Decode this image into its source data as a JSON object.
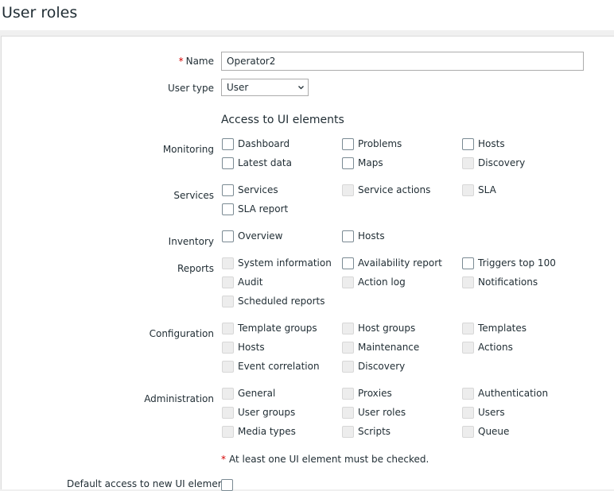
{
  "page": {
    "title": "User roles"
  },
  "form": {
    "name_label": "Name",
    "name_required_mark": "*",
    "name_value": "Operator2",
    "user_type_label": "User type",
    "user_type_value": "User",
    "section_heading": "Access to UI elements",
    "groups": [
      {
        "label": "Monitoring",
        "items": [
          {
            "label": "Dashboard",
            "checked": false,
            "disabled": false
          },
          {
            "label": "Problems",
            "checked": false,
            "disabled": false
          },
          {
            "label": "Hosts",
            "checked": false,
            "disabled": false
          },
          {
            "label": "Latest data",
            "checked": false,
            "disabled": false
          },
          {
            "label": "Maps",
            "checked": false,
            "disabled": false
          },
          {
            "label": "Discovery",
            "checked": false,
            "disabled": true
          }
        ]
      },
      {
        "label": "Services",
        "items": [
          {
            "label": "Services",
            "checked": false,
            "disabled": false
          },
          {
            "label": "Service actions",
            "checked": false,
            "disabled": true
          },
          {
            "label": "SLA",
            "checked": false,
            "disabled": true
          },
          {
            "label": "SLA report",
            "checked": false,
            "disabled": false
          }
        ]
      },
      {
        "label": "Inventory",
        "items": [
          {
            "label": "Overview",
            "checked": false,
            "disabled": false
          },
          {
            "label": "Hosts",
            "checked": false,
            "disabled": false
          }
        ]
      },
      {
        "label": "Reports",
        "items": [
          {
            "label": "System information",
            "checked": false,
            "disabled": true
          },
          {
            "label": "Availability report",
            "checked": false,
            "disabled": false
          },
          {
            "label": "Triggers top 100",
            "checked": false,
            "disabled": false
          },
          {
            "label": "Audit",
            "checked": false,
            "disabled": true
          },
          {
            "label": "Action log",
            "checked": false,
            "disabled": true
          },
          {
            "label": "Notifications",
            "checked": false,
            "disabled": true
          },
          {
            "label": "Scheduled reports",
            "checked": false,
            "disabled": true
          }
        ]
      },
      {
        "label": "Configuration",
        "items": [
          {
            "label": "Template groups",
            "checked": false,
            "disabled": true
          },
          {
            "label": "Host groups",
            "checked": false,
            "disabled": true
          },
          {
            "label": "Templates",
            "checked": false,
            "disabled": true
          },
          {
            "label": "Hosts",
            "checked": false,
            "disabled": true
          },
          {
            "label": "Maintenance",
            "checked": false,
            "disabled": true
          },
          {
            "label": "Actions",
            "checked": false,
            "disabled": true
          },
          {
            "label": "Event correlation",
            "checked": false,
            "disabled": true
          },
          {
            "label": "Discovery",
            "checked": false,
            "disabled": true
          }
        ]
      },
      {
        "label": "Administration",
        "items": [
          {
            "label": "General",
            "checked": false,
            "disabled": true
          },
          {
            "label": "Proxies",
            "checked": false,
            "disabled": true
          },
          {
            "label": "Authentication",
            "checked": false,
            "disabled": true
          },
          {
            "label": "User groups",
            "checked": false,
            "disabled": true
          },
          {
            "label": "User roles",
            "checked": false,
            "disabled": true
          },
          {
            "label": "Users",
            "checked": false,
            "disabled": true
          },
          {
            "label": "Media types",
            "checked": false,
            "disabled": true
          },
          {
            "label": "Scripts",
            "checked": false,
            "disabled": true
          },
          {
            "label": "Queue",
            "checked": false,
            "disabled": true
          }
        ]
      }
    ],
    "note_mark": "*",
    "note_text": "At least one UI element must be checked.",
    "next_row_label": "Default access to new UI elements"
  },
  "colors": {
    "required": "#d40000",
    "text": "#1f2c33",
    "border": "#acacac"
  },
  "icons": {
    "user_type_dropdown": "chevron-down-icon"
  }
}
